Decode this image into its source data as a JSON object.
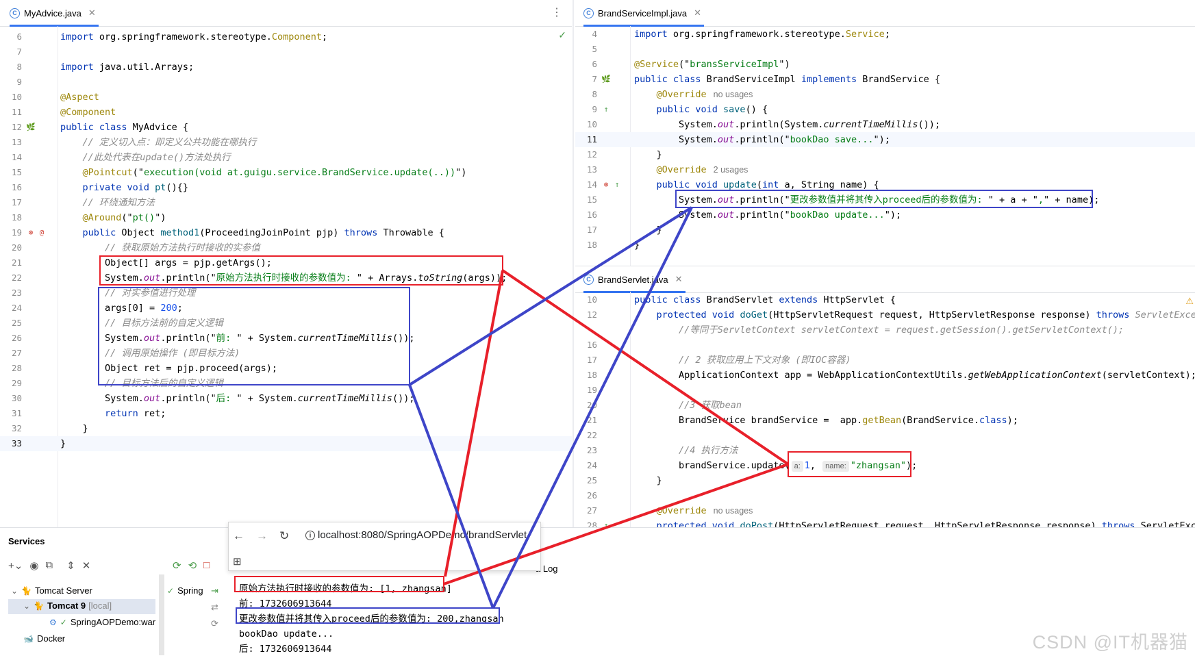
{
  "left_editor": {
    "tab": {
      "name": "MyAdvice.java",
      "icon": "java-class-icon"
    },
    "lines": [
      {
        "n": "6",
        "parts": [
          [
            "kw",
            "import"
          ],
          [
            "",
            "org.springframework.stereotype."
          ],
          [
            "an",
            "Component"
          ],
          [
            "",
            ";"
          ]
        ]
      },
      {
        "n": "7",
        "parts": []
      },
      {
        "n": "8",
        "parts": [
          [
            "kw",
            "import"
          ],
          [
            "",
            "java.util.Arrays;"
          ]
        ]
      },
      {
        "n": "9",
        "parts": []
      },
      {
        "n": "10",
        "parts": [
          [
            "an",
            "@Aspect"
          ]
        ]
      },
      {
        "n": "11",
        "parts": [
          [
            "an",
            "@Component"
          ]
        ]
      },
      {
        "n": "12",
        "parts": [
          [
            "kw",
            "public class"
          ],
          [
            "",
            "MyAdvice {"
          ]
        ],
        "gutter": [
          "bean"
        ]
      },
      {
        "n": "13",
        "parts": [
          [
            "cm",
            "    // 定义切入点：即定义公共功能在哪执行"
          ]
        ]
      },
      {
        "n": "14",
        "parts": [
          [
            "cm",
            "    //此处代表在update()方法处执行"
          ]
        ]
      },
      {
        "n": "15",
        "parts": [
          [
            "an",
            "    @Pointcut"
          ],
          [
            "",
            "(\""
          ],
          [
            "str",
            "execution(void at.guigu.service.BrandService.update(..))"
          ],
          [
            "",
            "\")"
          ]
        ]
      },
      {
        "n": "16",
        "parts": [
          [
            "kw",
            "    private void"
          ],
          [
            "fn",
            "pt"
          ],
          [
            "",
            "(){}"
          ]
        ]
      },
      {
        "n": "17",
        "parts": [
          [
            "cm",
            "    // 环绕通知方法"
          ]
        ]
      },
      {
        "n": "18",
        "parts": [
          [
            "an",
            "    @Around"
          ],
          [
            "",
            "(\""
          ],
          [
            "str",
            "pt()"
          ],
          [
            "",
            "\")"
          ]
        ]
      },
      {
        "n": "19",
        "parts": [
          [
            "kw",
            "    public"
          ],
          [
            "",
            "Object"
          ],
          [
            "fn",
            "method1"
          ],
          [
            "",
            "(ProceedingJoinPoint pjp)"
          ],
          [
            "kw",
            "throws"
          ],
          [
            "",
            "Throwable {"
          ]
        ],
        "gutter": [
          "red",
          "aspect"
        ]
      },
      {
        "n": "20",
        "parts": [
          [
            "cm",
            "        // 获取原始方法执行时接收的实参值"
          ]
        ]
      },
      {
        "n": "21",
        "parts": [
          [
            "",
            "        Object[] args = pjp.getArgs();"
          ]
        ]
      },
      {
        "n": "22",
        "parts": [
          [
            "",
            "        System."
          ],
          [
            "fld",
            "out"
          ],
          [
            "",
            ".println(\""
          ],
          [
            "str",
            "原始方法执行时接收的参数值为: "
          ],
          [
            "",
            "\" + Arrays."
          ],
          [
            "it",
            "toString"
          ],
          [
            "",
            "(args));"
          ]
        ]
      },
      {
        "n": "23",
        "parts": [
          [
            "cm",
            "        // 对实参值进行处理"
          ]
        ]
      },
      {
        "n": "24",
        "parts": [
          [
            "",
            "        args[0] = "
          ],
          [
            "num",
            "200"
          ],
          [
            "",
            ";"
          ]
        ]
      },
      {
        "n": "25",
        "parts": [
          [
            "cm",
            "        // 目标方法前的自定义逻辑"
          ]
        ]
      },
      {
        "n": "26",
        "parts": [
          [
            "",
            "        System."
          ],
          [
            "fld",
            "out"
          ],
          [
            "",
            ".println(\""
          ],
          [
            "str",
            "前: "
          ],
          [
            "",
            "\" + System."
          ],
          [
            "it",
            "currentTimeMillis"
          ],
          [
            "",
            "());"
          ]
        ]
      },
      {
        "n": "27",
        "parts": [
          [
            "cm",
            "        // 调用原始操作 (即目标方法)"
          ]
        ]
      },
      {
        "n": "28",
        "parts": [
          [
            "",
            "        Object ret = pjp.proceed(args);"
          ]
        ]
      },
      {
        "n": "29",
        "parts": [
          [
            "cm",
            "        // 目标方法后的自定义逻辑"
          ]
        ]
      },
      {
        "n": "30",
        "parts": [
          [
            "",
            "        System."
          ],
          [
            "fld",
            "out"
          ],
          [
            "",
            ".println(\""
          ],
          [
            "str",
            "后: "
          ],
          [
            "",
            "\" + System."
          ],
          [
            "it",
            "currentTimeMillis"
          ],
          [
            "",
            "());"
          ]
        ]
      },
      {
        "n": "31",
        "parts": [
          [
            "kw",
            "        return"
          ],
          [
            "",
            "ret;"
          ]
        ]
      },
      {
        "n": "32",
        "parts": [
          [
            "",
            "    }"
          ]
        ]
      },
      {
        "n": "33",
        "parts": [
          [
            "",
            "}"
          ]
        ],
        "current": true
      }
    ]
  },
  "right_top_editor": {
    "tab": {
      "name": "BrandServiceImpl.java",
      "icon": "java-class-icon"
    },
    "lines": [
      {
        "n": "4",
        "parts": [
          [
            "kw",
            "import"
          ],
          [
            "",
            "org.springframework.stereotype."
          ],
          [
            "an",
            "Service"
          ],
          [
            "",
            ";"
          ]
        ]
      },
      {
        "n": "5",
        "parts": []
      },
      {
        "n": "6",
        "parts": [
          [
            "an",
            "@Service"
          ],
          [
            "",
            "(\""
          ],
          [
            "str",
            "bransServiceImpl"
          ],
          [
            "",
            "\")"
          ]
        ]
      },
      {
        "n": "7",
        "parts": [
          [
            "kw",
            "public class"
          ],
          [
            "",
            "BrandServiceImpl"
          ],
          [
            "kw",
            "implements"
          ],
          [
            "",
            "BrandService {"
          ]
        ],
        "gutter": [
          "bean"
        ]
      },
      {
        "n": "8",
        "parts": [
          [
            "an",
            "    @Override"
          ]
        ],
        "usage": "no usages"
      },
      {
        "n": "9",
        "parts": [
          [
            "kw",
            "    public void"
          ],
          [
            "fn",
            "save"
          ],
          [
            "",
            "() {"
          ]
        ],
        "gutter": [
          "impl"
        ]
      },
      {
        "n": "10",
        "parts": [
          [
            "",
            "        System."
          ],
          [
            "fld",
            "out"
          ],
          [
            "",
            ".println(System."
          ],
          [
            "it",
            "currentTimeMillis"
          ],
          [
            "",
            "());"
          ]
        ]
      },
      {
        "n": "11",
        "parts": [
          [
            "",
            "        System."
          ],
          [
            "fld",
            "out"
          ],
          [
            "",
            ".println(\""
          ],
          [
            "str",
            "bookDao save..."
          ],
          [
            "",
            "\");"
          ]
        ],
        "current": true
      },
      {
        "n": "12",
        "parts": [
          [
            "",
            "    }"
          ]
        ]
      },
      {
        "n": "13",
        "parts": [
          [
            "an",
            "    @Override"
          ]
        ],
        "usage": "2 usages"
      },
      {
        "n": "14",
        "parts": [
          [
            "kw",
            "    public void"
          ],
          [
            "fn",
            "update"
          ],
          [
            "",
            "("
          ],
          [
            "kw",
            "int"
          ],
          [
            "",
            "a, String name) {"
          ]
        ],
        "gutter": [
          "red",
          "impl"
        ]
      },
      {
        "n": "15",
        "parts": [
          [
            "",
            "        System."
          ],
          [
            "fld",
            "out"
          ],
          [
            "",
            ".println(\""
          ],
          [
            "str",
            "更改参数值并将其传入proceed后的参数值为: "
          ],
          [
            "",
            "\" + a + \""
          ],
          [
            "str",
            ","
          ],
          [
            "",
            "\" + name);"
          ]
        ]
      },
      {
        "n": "16",
        "parts": [
          [
            "",
            "        System."
          ],
          [
            "fld",
            "out"
          ],
          [
            "",
            ".println(\""
          ],
          [
            "str",
            "bookDao update..."
          ],
          [
            "",
            "\");"
          ]
        ]
      },
      {
        "n": "17",
        "parts": [
          [
            "",
            "    }"
          ]
        ]
      },
      {
        "n": "18",
        "parts": [
          [
            "",
            "}"
          ]
        ]
      }
    ]
  },
  "right_bottom_editor": {
    "tab": {
      "name": "BrandServlet.java",
      "icon": "java-class-icon"
    },
    "lines": [
      {
        "n": "10",
        "parts": [
          [
            "kw",
            "public class"
          ],
          [
            "",
            "BrandServlet"
          ],
          [
            "kw",
            "extends"
          ],
          [
            "",
            "HttpServlet {"
          ]
        ]
      },
      {
        "n": "12",
        "parts": [
          [
            "kw",
            "    protected void"
          ],
          [
            "fn",
            "doGet"
          ],
          [
            "",
            "(HttpServletRequest request, HttpServletResponse response)"
          ],
          [
            "kw",
            "throws"
          ],
          [
            "cm",
            "ServletExcept"
          ]
        ]
      },
      {
        "n": "",
        "parts": [
          [
            "cm",
            "        //等同于ServletContext servletContext = request.getSession().getServletContext();"
          ]
        ]
      },
      {
        "n": "16",
        "parts": []
      },
      {
        "n": "17",
        "parts": [
          [
            "cm",
            "        // 2 获取应用上下文对象 (即IOC容器)"
          ]
        ]
      },
      {
        "n": "18",
        "parts": [
          [
            "",
            "        ApplicationContext app = WebApplicationContextUtils."
          ],
          [
            "it",
            "getWebApplicationContext"
          ],
          [
            "",
            "(servletContext);"
          ]
        ]
      },
      {
        "n": "19",
        "parts": []
      },
      {
        "n": "20",
        "parts": [
          [
            "cm",
            "        //3 获取bean"
          ]
        ]
      },
      {
        "n": "21",
        "parts": [
          [
            "",
            "        BrandService brandService =  app."
          ],
          [
            "an",
            "getBean"
          ],
          [
            "",
            "(BrandService."
          ],
          [
            "kw",
            "class"
          ],
          [
            "",
            ");"
          ]
        ]
      },
      {
        "n": "22",
        "parts": []
      },
      {
        "n": "23",
        "parts": [
          [
            "cm",
            "        //4 执行方法"
          ]
        ]
      },
      {
        "n": "24",
        "parts": [
          [
            "",
            "        brandService.update("
          ],
          [
            "hint",
            "a:"
          ],
          [
            "num",
            "1"
          ],
          [
            "",
            ", "
          ],
          [
            "hint",
            "name:"
          ],
          [
            "str",
            "\"zhangsan\""
          ],
          [
            "",
            ");"
          ]
        ]
      },
      {
        "n": "25",
        "parts": [
          [
            "",
            "    }"
          ]
        ]
      },
      {
        "n": "26",
        "parts": []
      },
      {
        "n": "27",
        "parts": [
          [
            "an",
            "    @Override"
          ]
        ],
        "usage": "no usages"
      },
      {
        "n": "28",
        "parts": [
          [
            "kw",
            "    protected void"
          ],
          [
            "fn",
            "doPost"
          ],
          [
            "",
            "(HttpServletRequest request, HttpServletResponse response)"
          ],
          [
            "kw",
            "throws"
          ],
          [
            "",
            "ServletExcep"
          ]
        ],
        "gutter": [
          "impl"
        ]
      }
    ]
  },
  "services": {
    "title": "Services",
    "tree": {
      "server": "Tomcat Server",
      "instance": "Tomcat 9",
      "instance_tag": "[local]",
      "artifact": "SpringAOPDemo:war",
      "docker": "Docker"
    },
    "spring_label": "Spring",
    "log_tab_fragment": "a Log"
  },
  "browser": {
    "url": "localhost:8080/SpringAOPDemo/brandServlet"
  },
  "console": {
    "lines": [
      "原始方法执行时接收的参数值为: [1, zhangsan]",
      "前: 1732606913644",
      "更改参数值并将其传入proceed后的参数值为: 200,zhangsan",
      "bookDao update...",
      "后: 1732606913644"
    ]
  },
  "watermark": "CSDN @IT机器猫",
  "colors": {
    "red_annotation": "#e8202a",
    "blue_annotation": "#3e45c8",
    "keyword": "#0033b3",
    "annotation": "#9e880d",
    "string": "#067d17",
    "comment": "#8c8c8c",
    "field": "#871094",
    "number": "#1750eb"
  }
}
